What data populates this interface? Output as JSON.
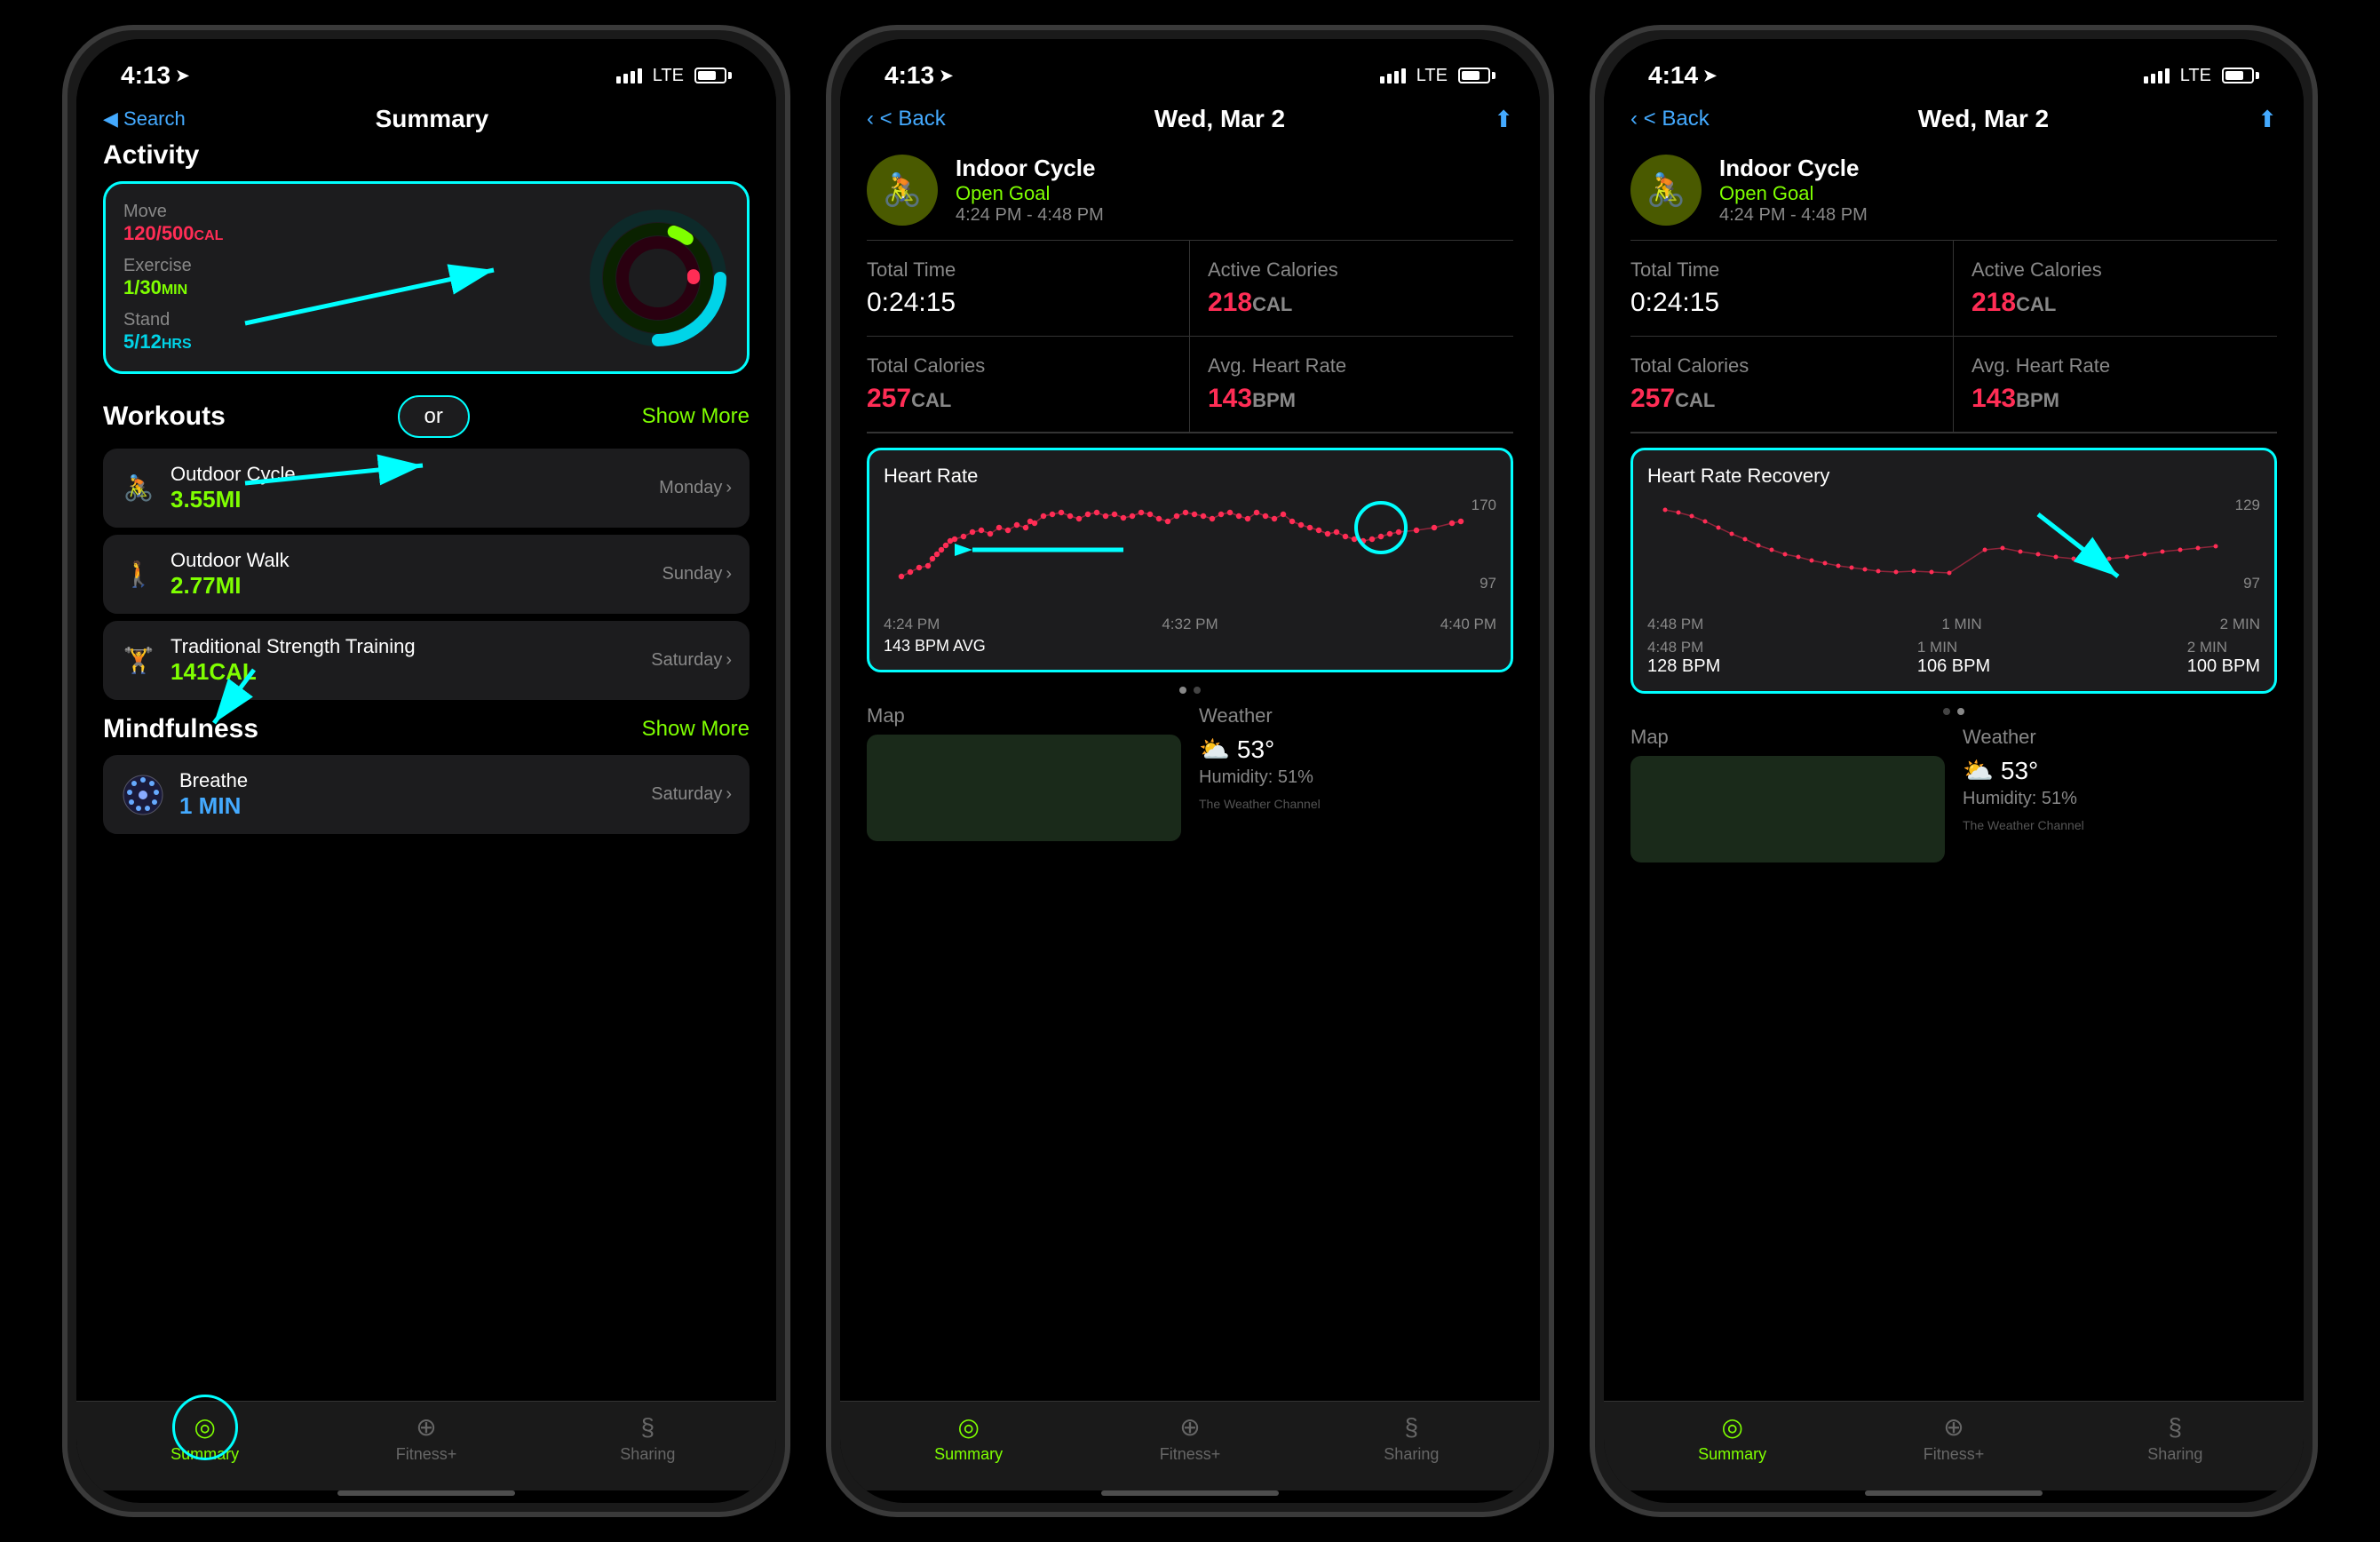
{
  "phones": [
    {
      "id": "phone1",
      "statusBar": {
        "time": "4:13",
        "hasArrow": true,
        "signal": "LTE",
        "battery": 70
      },
      "navBar": {
        "backLabel": "◀ Search",
        "title": "Summary",
        "showShare": false
      },
      "screen": "summary",
      "activity": {
        "sectionTitle": "Activity",
        "move": {
          "label": "Move",
          "value": "120/500",
          "unit": "CAL"
        },
        "exercise": {
          "label": "Exercise",
          "value": "1/30",
          "unit": "MIN"
        },
        "stand": {
          "label": "Stand",
          "value": "5/12",
          "unit": "HRS"
        }
      },
      "workouts": {
        "sectionTitle": "Workouts",
        "showMore": "Show More",
        "orButton": "or",
        "items": [
          {
            "icon": "🚴",
            "name": "Outdoor Cycle",
            "value": "3.55MI",
            "day": "Monday"
          },
          {
            "icon": "🚶",
            "name": "Outdoor Walk",
            "value": "2.77MI",
            "day": "Sunday"
          },
          {
            "icon": "🏋",
            "name": "Traditional Strength Training",
            "value": "141CAL",
            "day": "Saturday"
          }
        ]
      },
      "mindfulness": {
        "sectionTitle": "Mindfulness",
        "showMore": "Show More",
        "items": [
          {
            "name": "Breathe",
            "value": "1 MIN",
            "day": "Saturday"
          }
        ]
      },
      "tabBar": {
        "tabs": [
          {
            "label": "Summary",
            "icon": "◎",
            "active": true
          },
          {
            "label": "Fitness+",
            "icon": "⊕",
            "active": false
          },
          {
            "label": "Sharing",
            "icon": "§",
            "active": false
          }
        ]
      }
    },
    {
      "id": "phone2",
      "statusBar": {
        "time": "4:13",
        "hasArrow": true,
        "signal": "LTE",
        "battery": 70
      },
      "navBar": {
        "backLabel": "< Back",
        "title": "Wed, Mar 2",
        "showShare": true
      },
      "screen": "workoutDetail",
      "workoutDetail": {
        "type": "Indoor Cycle",
        "goal": "Open Goal",
        "timeRange": "4:24 PM - 4:48 PM",
        "stats": [
          {
            "label": "Total Time",
            "value": "0:24:15",
            "valueColor": "white"
          },
          {
            "label": "Active Calories",
            "value": "218",
            "unit": "CAL",
            "valueColor": "red"
          },
          {
            "label": "Total Calories",
            "value": "257",
            "unit": "CAL",
            "valueColor": "red"
          },
          {
            "label": "Avg. Heart Rate",
            "value": "143",
            "unit": "BPM",
            "valueColor": "red"
          }
        ],
        "chartTitle": "Heart Rate",
        "chartMax": "170",
        "chartMin": "97",
        "chartTimes": [
          "4:24 PM",
          "4:32 PM",
          "4:40 PM"
        ],
        "chartAvg": "143 BPM AVG",
        "paginationDots": [
          true,
          false
        ],
        "weather": {
          "title": "Weather",
          "icon": "⛅",
          "temp": "53°",
          "humidity": "Humidity: 51%"
        },
        "map": {
          "title": "Map"
        }
      },
      "tabBar": {
        "tabs": [
          {
            "label": "Summary",
            "icon": "◎",
            "active": true
          },
          {
            "label": "Fitness+",
            "icon": "⊕",
            "active": false
          },
          {
            "label": "Sharing",
            "icon": "§",
            "active": false
          }
        ]
      }
    },
    {
      "id": "phone3",
      "statusBar": {
        "time": "4:14",
        "hasArrow": true,
        "signal": "LTE",
        "battery": 70
      },
      "navBar": {
        "backLabel": "< Back",
        "title": "Wed, Mar 2",
        "showShare": true
      },
      "screen": "workoutDetailHRR",
      "workoutDetail": {
        "type": "Indoor Cycle",
        "goal": "Open Goal",
        "timeRange": "4:24 PM - 4:48 PM",
        "stats": [
          {
            "label": "Total Time",
            "value": "0:24:15",
            "valueColor": "white"
          },
          {
            "label": "Active Calories",
            "value": "218",
            "unit": "CAL",
            "valueColor": "red"
          },
          {
            "label": "Total Calories",
            "value": "257",
            "unit": "CAL",
            "valueColor": "red"
          },
          {
            "label": "Avg. Heart Rate",
            "value": "143",
            "unit": "BPM",
            "valueColor": "red"
          }
        ],
        "chartTitle": "Heart Rate Recovery",
        "chartMax": "129",
        "chartMin": "97",
        "chartTimes": [
          "4:48 PM",
          "1 MIN",
          "2 MIN"
        ],
        "chartAvgItems": [
          "128 BPM",
          "106 BPM",
          "100 BPM"
        ],
        "chartAvgLabels": [
          "4:48 PM",
          "1 MIN",
          "2 MIN"
        ],
        "paginationDots": [
          false,
          true
        ],
        "weather": {
          "title": "Weather",
          "icon": "⛅",
          "temp": "53°",
          "humidity": "Humidity: 51%"
        },
        "map": {
          "title": "Map"
        }
      },
      "tabBar": {
        "tabs": [
          {
            "label": "Summary",
            "icon": "◎",
            "active": true
          },
          {
            "label": "Fitness+",
            "icon": "⊕",
            "active": false
          },
          {
            "label": "Sharing",
            "icon": "§",
            "active": false
          }
        ]
      }
    }
  ]
}
